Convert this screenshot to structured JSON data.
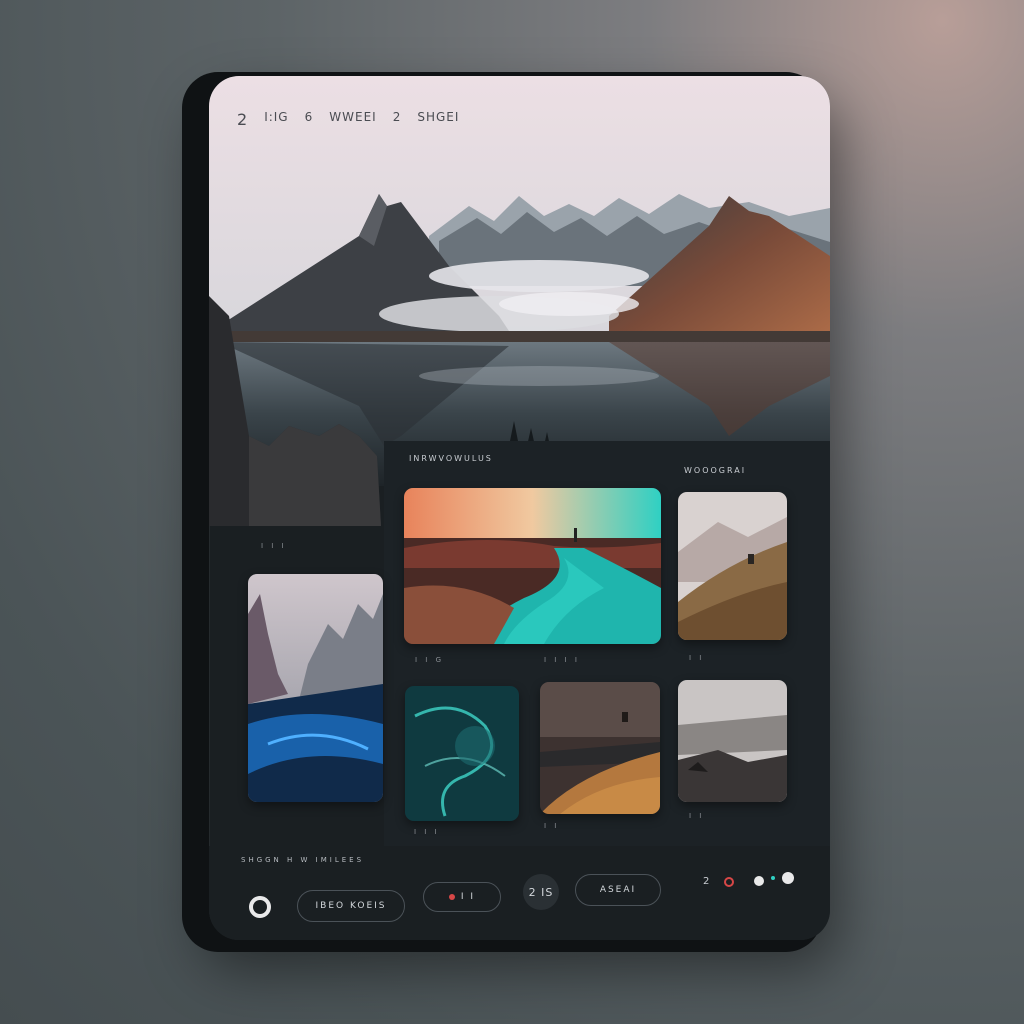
{
  "status_bar": {
    "left_num": "2",
    "text1": "I:IG",
    "num2": "6",
    "text2": "WWEEI",
    "num3": "2",
    "text3": "SHGEI"
  },
  "gallery": {
    "section_title": "INRWVOWULUS",
    "side_title": "WOOOGRAI",
    "captions": {
      "left_top": "I I I",
      "featured_left": "I I G",
      "featured_right": "I I I I",
      "side_top": "I I",
      "row2_left": "I I I",
      "row2_mid": "I I",
      "row2_right": "I I"
    }
  },
  "bottom_bar": {
    "label": "SHGGN H W IMILEES",
    "pill1": "IBEO KOEIS",
    "pill2": "I I",
    "center_badge": "2 IS",
    "pill3": "ASEAI",
    "page_num": "2"
  },
  "colors": {
    "accent_red": "#d74747",
    "accent_teal": "#2fd0c3",
    "indicator_white": "#e9e9ea"
  }
}
